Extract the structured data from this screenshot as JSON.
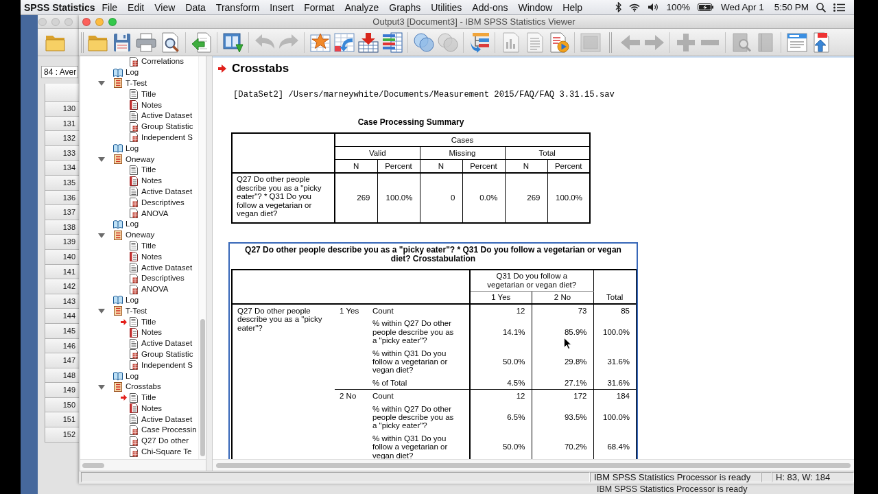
{
  "menu_bar": {
    "app_name": "SPSS Statistics",
    "menus": [
      "File",
      "Edit",
      "View",
      "Data",
      "Transform",
      "Insert",
      "Format",
      "Analyze",
      "Graphs",
      "Utilities",
      "Add-ons",
      "Window",
      "Help"
    ],
    "battery": "100%",
    "date": "Wed Apr 1",
    "time": "5:50 PM"
  },
  "data_editor_window": {
    "cell_reference": "84 : Aver",
    "row_numbers": [
      "130",
      "131",
      "132",
      "133",
      "134",
      "135",
      "136",
      "137",
      "138",
      "139",
      "140",
      "141",
      "142",
      "143",
      "144",
      "145",
      "146",
      "147",
      "148",
      "149",
      "150",
      "151",
      "152"
    ],
    "status": "IBM SPSS Statistics Processor is ready"
  },
  "viewer_window": {
    "title": "Output3 [Document3] - IBM SPSS Statistics Viewer",
    "toolbar": [
      [
        {
          "disabled": false
        },
        {
          "disabled": false
        },
        {
          "disabled": false
        },
        {
          "disabled": false
        }
      ],
      [
        {
          "disabled": false
        }
      ],
      [
        {
          "disabled": false
        }
      ],
      [
        {
          "disabled": true
        },
        {
          "disabled": true
        }
      ],
      [
        {
          "disabled": false
        },
        {
          "disabled": false
        },
        {
          "disabled": false
        },
        {
          "disabled": false
        }
      ],
      [
        {
          "disabled": false
        },
        {
          "disabled": true
        }
      ],
      [
        {
          "disabled": false
        }
      ],
      [
        {
          "disabled": true
        },
        {
          "disabled": true
        },
        {
          "disabled": false
        }
      ],
      [
        {
          "disabled": true
        }
      ],
      [
        {
          "disabled": true
        },
        {
          "disabled": true
        }
      ],
      [
        {
          "disabled": true
        },
        {
          "disabled": true
        }
      ],
      [
        {
          "disabled": true
        },
        {
          "disabled": true
        }
      ],
      [
        {
          "disabled": false
        },
        {
          "disabled": false
        }
      ]
    ]
  },
  "outline": [
    {
      "children": [
        {
          "label": "Correlations",
          "kind": "table",
          "current": false
        }
      ]
    },
    {
      "label": "Log",
      "kind": "log",
      "current": false
    },
    {
      "label": "T-Test",
      "kind": "procedure",
      "current": false,
      "expanded": true,
      "children": [
        {
          "label": "Title",
          "kind": "title",
          "current": false
        },
        {
          "label": "Notes",
          "kind": "notes",
          "current": false
        },
        {
          "label": "Active Dataset",
          "kind": "text",
          "current": false
        },
        {
          "label": "Group Statistic",
          "kind": "table",
          "current": false
        },
        {
          "label": "Independent S",
          "kind": "table",
          "current": false
        }
      ]
    },
    {
      "label": "Log",
      "kind": "log",
      "current": false
    },
    {
      "label": "Oneway",
      "kind": "procedure",
      "current": false,
      "expanded": true,
      "children": [
        {
          "label": "Title",
          "kind": "title",
          "current": false
        },
        {
          "label": "Notes",
          "kind": "notes",
          "current": false
        },
        {
          "label": "Active Dataset",
          "kind": "text",
          "current": false
        },
        {
          "label": "Descriptives",
          "kind": "table",
          "current": false
        },
        {
          "label": "ANOVA",
          "kind": "table",
          "current": false
        }
      ]
    },
    {
      "label": "Log",
      "kind": "log",
      "current": false
    },
    {
      "label": "Oneway",
      "kind": "procedure",
      "current": false,
      "expanded": true,
      "children": [
        {
          "label": "Title",
          "kind": "title",
          "current": false
        },
        {
          "label": "Notes",
          "kind": "notes",
          "current": false
        },
        {
          "label": "Active Dataset",
          "kind": "text",
          "current": false
        },
        {
          "label": "Descriptives",
          "kind": "table",
          "current": false
        },
        {
          "label": "ANOVA",
          "kind": "table",
          "current": false
        }
      ]
    },
    {
      "label": "Log",
      "kind": "log",
      "current": false
    },
    {
      "label": "T-Test",
      "kind": "procedure",
      "current": false,
      "expanded": true,
      "children": [
        {
          "label": "Title",
          "kind": "title",
          "current": true
        },
        {
          "label": "Notes",
          "kind": "notes",
          "current": false
        },
        {
          "label": "Active Dataset",
          "kind": "text",
          "current": false
        },
        {
          "label": "Group Statistic",
          "kind": "table",
          "current": false
        },
        {
          "label": "Independent S",
          "kind": "table",
          "current": false
        }
      ]
    },
    {
      "label": "Log",
      "kind": "log",
      "current": false
    },
    {
      "label": "Crosstabs",
      "kind": "procedure",
      "current": false,
      "expanded": true,
      "children": [
        {
          "label": "Title",
          "kind": "title",
          "current": true
        },
        {
          "label": "Notes",
          "kind": "notes",
          "current": false
        },
        {
          "label": "Active Dataset",
          "kind": "text",
          "current": false
        },
        {
          "label": "Case Processin",
          "kind": "table",
          "current": false
        },
        {
          "label": "Q27 Do other",
          "kind": "table",
          "current": false
        },
        {
          "label": "Chi-Square Te",
          "kind": "table",
          "current": false
        }
      ]
    }
  ],
  "output": {
    "heading": {
      "text": "Crosstabs",
      "current": true
    },
    "dataset_line": "[DataSet2] /Users/marneywhite/Documents/Measurement 2015/FAQ/FAQ 3.31.15.sav",
    "case_processing_summary": {
      "title": "Case Processing Summary",
      "spanner": "Cases",
      "groups": [
        {
          "label": "Valid",
          "columns": [
            "N",
            "Percent"
          ]
        },
        {
          "label": "Missing",
          "columns": [
            "N",
            "Percent"
          ]
        },
        {
          "label": "Total",
          "columns": [
            "N",
            "Percent"
          ]
        }
      ],
      "rows": [
        {
          "label": "Q27 Do other people describe you as a \"picky eater\"? * Q31 Do you follow a vegetarian or vegan diet?",
          "values": [
            "269",
            "100.0%",
            "0",
            "0.0%",
            "269",
            "100.0%"
          ]
        }
      ]
    },
    "crosstabulation": {
      "selected": true,
      "title": "Q27 Do other people describe you as a \"picky eater\"? * Q31 Do you follow a vegetarian or vegan diet? Crosstabulation",
      "column_variable": "Q31 Do you follow a vegetarian or vegan diet?",
      "column_categories": [
        "1 Yes",
        "2 No"
      ],
      "total_label": "Total",
      "row_variable": "Q27 Do other people describe you as a \"picky eater\"?",
      "row_groups": [
        {
          "category": "1 Yes",
          "statistics": [
            {
              "label": "Count",
              "values": [
                "12",
                "73",
                "85"
              ]
            },
            {
              "label": "% within Q27 Do other people describe you as a \"picky eater\"?",
              "values": [
                "14.1%",
                "85.9%",
                "100.0%"
              ]
            },
            {
              "label": "% within Q31 Do you follow a vegetarian or vegan diet?",
              "values": [
                "50.0%",
                "29.8%",
                "31.6%"
              ]
            },
            {
              "label": "% of Total",
              "values": [
                "4.5%",
                "27.1%",
                "31.6%"
              ]
            }
          ]
        },
        {
          "category": "2 No",
          "statistics": [
            {
              "label": "Count",
              "values": [
                "12",
                "172",
                "184"
              ]
            },
            {
              "label": "% within Q27 Do other people describe you as a \"picky eater\"?",
              "values": [
                "6.5%",
                "93.5%",
                "100.0%"
              ]
            },
            {
              "label": "% within Q31 Do you follow a vegetarian or vegan diet?",
              "values": [
                "50.0%",
                "70.2%",
                "68.4%"
              ]
            }
          ]
        }
      ]
    }
  },
  "status_bar": {
    "message": "IBM SPSS Statistics Processor is ready",
    "dimensions": "H: 83, W: 184"
  }
}
